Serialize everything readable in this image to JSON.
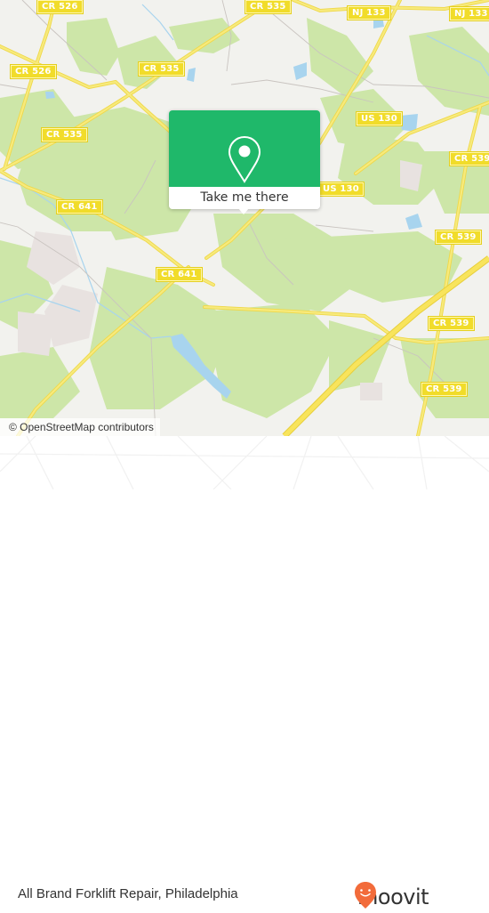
{
  "map": {
    "attribution": "© OpenStreetMap contributors",
    "road_labels": [
      {
        "id": "cr526-top",
        "text": "CR 526"
      },
      {
        "id": "cr526-left",
        "text": "CR 526"
      },
      {
        "id": "cr535-upper",
        "text": "CR 535"
      },
      {
        "id": "cr535-top",
        "text": "CR 535"
      },
      {
        "id": "cr535-left",
        "text": "CR 535"
      },
      {
        "id": "nj133-a",
        "text": "NJ 133"
      },
      {
        "id": "nj133-b",
        "text": "NJ 133"
      },
      {
        "id": "us130-upper",
        "text": "US 130"
      },
      {
        "id": "us130-lower",
        "text": "US 130"
      },
      {
        "id": "cr539-a",
        "text": "CR 539"
      },
      {
        "id": "cr539-b",
        "text": "CR 539"
      },
      {
        "id": "cr539-c",
        "text": "CR 539"
      },
      {
        "id": "cr539-d",
        "text": "CR 539"
      },
      {
        "id": "cr641-a",
        "text": "CR 641"
      },
      {
        "id": "cr641-b",
        "text": "CR 641"
      }
    ],
    "colors": {
      "land": "#f2f2ee",
      "forest": "#cde6a8",
      "water": "#a8d4ee",
      "road": "#f5e15a",
      "shield": "#f1dc2a",
      "popup": "#1fb86a"
    }
  },
  "popup": {
    "icon": "location-pin-icon",
    "button_label": "Take me there"
  },
  "footer": {
    "place_name": "All Brand Forklift Repair, Philadelphia",
    "logo_text": "moovit",
    "logo_icon": "moovit-pin-icon",
    "logo_color": "#f26b3a"
  }
}
